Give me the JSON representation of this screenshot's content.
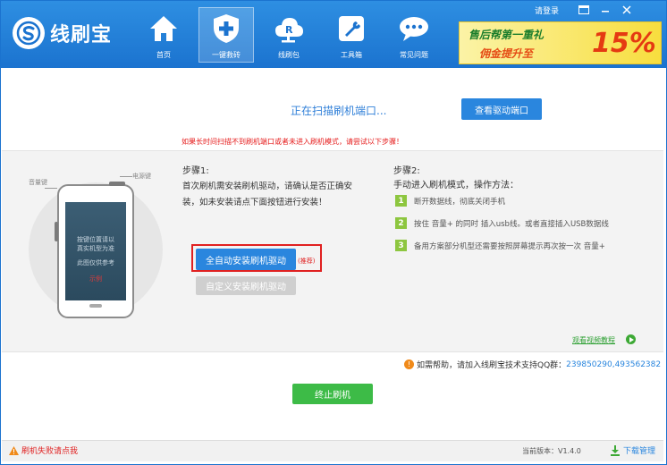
{
  "app": {
    "name": "线刷宝"
  },
  "nav": {
    "items": [
      {
        "label": "首页",
        "icon": "home-icon"
      },
      {
        "label": "一键救砖",
        "icon": "shield-plus-icon",
        "active": true
      },
      {
        "label": "线刷包",
        "icon": "cloud-rom-icon"
      },
      {
        "label": "工具箱",
        "icon": "wrench-icon"
      },
      {
        "label": "常见问题",
        "icon": "chat-icon"
      }
    ]
  },
  "top_links": {
    "login": "请登录"
  },
  "ad": {
    "line1": "售后帮第一重礼",
    "line2": "佣金提升至",
    "percent": "15%"
  },
  "scan": {
    "status": "正在扫描刷机端口...",
    "view_driver_button": "查看驱动端口",
    "warning": "如果长时间扫描不到刷机端口或者未进入刷机模式，请尝试以下步骤！"
  },
  "phone": {
    "vol_label": "音量键",
    "power_label": "电源键",
    "screen_line1": "按键位置请以",
    "screen_line2": "真实机型为准",
    "screen_line3": "此图仅供参考",
    "screen_line4": "示例"
  },
  "step1": {
    "title": "步骤1:",
    "description": "首次刷机需安装刷机驱动，请确认是否正确安装，如未安装请点下面按钮进行安装！",
    "auto_install_button": "全自动安装刷机驱动",
    "recommend": "(推荐)",
    "custom_install_button": "自定义安装刷机驱动"
  },
  "step2": {
    "title": "步骤2:",
    "description": "手动进入刷机模式，操作方法：",
    "steps": [
      {
        "num": "1",
        "text": "断开数据线，彻底关闭手机"
      },
      {
        "num": "2",
        "text": "按住 音量+  的同时  插入usb线。或者直接插入USB数据线"
      },
      {
        "num": "3",
        "text": "备用方案部分机型还需要按照屏幕提示再次按一次 音量+"
      }
    ],
    "video_link": "观看视频教程"
  },
  "help": {
    "prefix": "如需帮助，请加入线刷宝技术支持QQ群：",
    "qq": "239850290,493562382"
  },
  "stop_button": "终止刷机",
  "footer": {
    "fail_link": "刷机失败请点我",
    "version": "当前版本：V1.4.0",
    "download": "下载管理"
  },
  "colors": {
    "header": "#1b73cf",
    "primary_button": "#2a86de",
    "stop_button": "#3dbb47",
    "warning": "#e61d1d",
    "step_badge": "#8dc63f"
  }
}
